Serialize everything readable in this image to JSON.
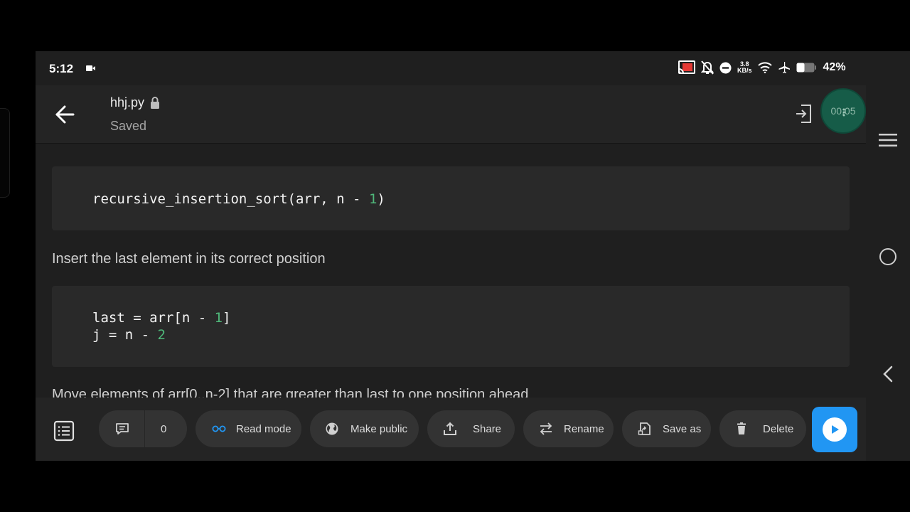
{
  "status_bar": {
    "time": "5:12",
    "net_speed_value": "3.8",
    "net_speed_unit": "KB/s",
    "battery_percent": "42%",
    "icons": [
      "video-camera-icon",
      "cast-icon",
      "notifications-off-icon",
      "do-not-disturb-icon",
      "wifi-icon",
      "airplane-icon",
      "battery-icon"
    ]
  },
  "header": {
    "file_name": "hhj.py",
    "save_status": "Saved",
    "timer": "00:05"
  },
  "content": {
    "code_block_1": {
      "prefix": "recursive_insertion_sort(arr, n - ",
      "number": "1",
      "suffix": ")"
    },
    "paragraph_1": "Insert the last element in its correct position",
    "code_block_2": {
      "line1_prefix": "last = arr[n - ",
      "line1_number": "1",
      "line1_suffix": "]",
      "line2_prefix": "j = n - ",
      "line2_number": "2"
    },
    "paragraph_2": "Move elements of arr[0..n-2] that are greater than last to one position ahead"
  },
  "bottom_bar": {
    "comment_count": "0",
    "read_mode": "Read mode",
    "make_public": "Make public",
    "share": "Share",
    "rename": "Rename",
    "save_as": "Save as",
    "delete": "Delete"
  },
  "colors": {
    "background": "#1f1f1f",
    "code_block": "#292929",
    "number_literal": "#4fb87a",
    "accent_blue": "#2196f3",
    "timer_green": "#165c48"
  }
}
